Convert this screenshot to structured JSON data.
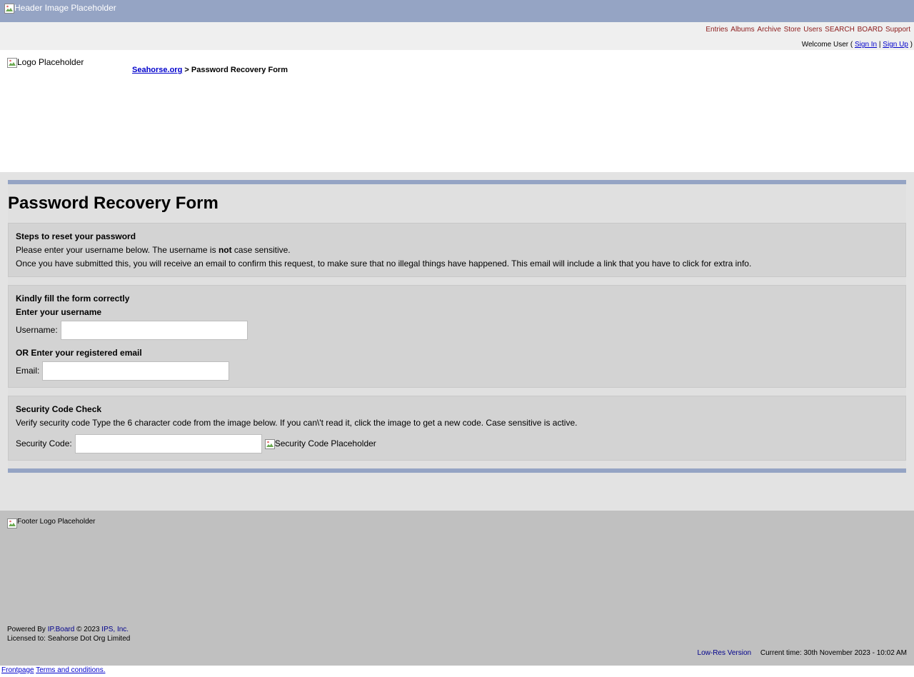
{
  "header": {
    "image_alt": "Header Image Placeholder"
  },
  "nav": {
    "links": [
      "Entries",
      "Albums",
      "Archive",
      "Store",
      "Users",
      "SEARCH",
      "BOARD",
      "Support"
    ],
    "welcome_prefix": "Welcome User (",
    "sign_in": "Sign In",
    "separator": "|",
    "sign_up": "Sign Up",
    "welcome_suffix": ")"
  },
  "logo": {
    "image_alt": "Logo Placeholder"
  },
  "breadcrumb": {
    "home": "Seahorse.org",
    "sep": ">",
    "current": "Password Recovery Form"
  },
  "main": {
    "title": "Password Recovery Form",
    "steps": {
      "title": "Steps to reset your password",
      "line1_pre": "Please enter your username below. The username is ",
      "line1_bold": "not",
      "line1_post": " case sensitive.",
      "line2": "Once you have submitted this, you will receive an email to confirm this request, to make sure that no illegal things have happened. This email will include a link that you have to click for extra info."
    },
    "form": {
      "title": "Kindly fill the form correctly",
      "username_heading": "Enter your username",
      "username_label": "Username:",
      "username_value": "",
      "email_heading": "OR Enter your registered email",
      "email_label": "Email:",
      "email_value": ""
    },
    "security": {
      "title": "Security Code Check",
      "desc": "Verify security code Type the 6 character code from the image below. If you can\\'t read it, click the image to get a new code. Case sensitive is active.",
      "label": "Security Code:",
      "value": "",
      "image_alt": "Security Code Placeholder"
    }
  },
  "footer": {
    "logo_alt": "Footer Logo Placeholder",
    "powered_prefix": "Powered By",
    "powered_product": "IP.Board",
    "copyright": "© 2023",
    "company": "IPS, Inc.",
    "licensed": "Licensed to: Seahorse Dot Org Limited",
    "lowres": "Low-Res Version",
    "current_time": "Current time: 30th November 2023 - 10:02 AM"
  },
  "bottom": {
    "frontpage": "Frontpage",
    "terms": "Terms and conditions."
  },
  "colors": {
    "header": "#95a4c4",
    "nav_link": "#8b1a1a",
    "panel": "#d3d3d3",
    "footer": "#c0c0c0"
  }
}
